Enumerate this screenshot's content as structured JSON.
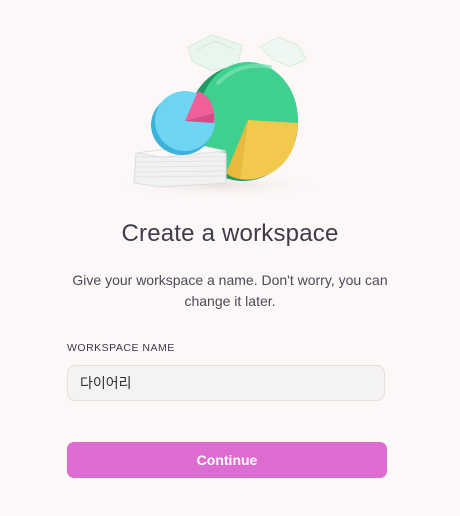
{
  "page": {
    "title": "Create a workspace",
    "subtitle": "Give your workspace a name. Don't worry, you can change it later."
  },
  "form": {
    "label": "WORKSPACE NAME",
    "value": "다이어리"
  },
  "actions": {
    "continue_label": "Continue"
  },
  "colors": {
    "background": "#fdf7f7",
    "accent": "#dc6ccf"
  },
  "illustration": {
    "icon": "pie-chart-illustration"
  }
}
